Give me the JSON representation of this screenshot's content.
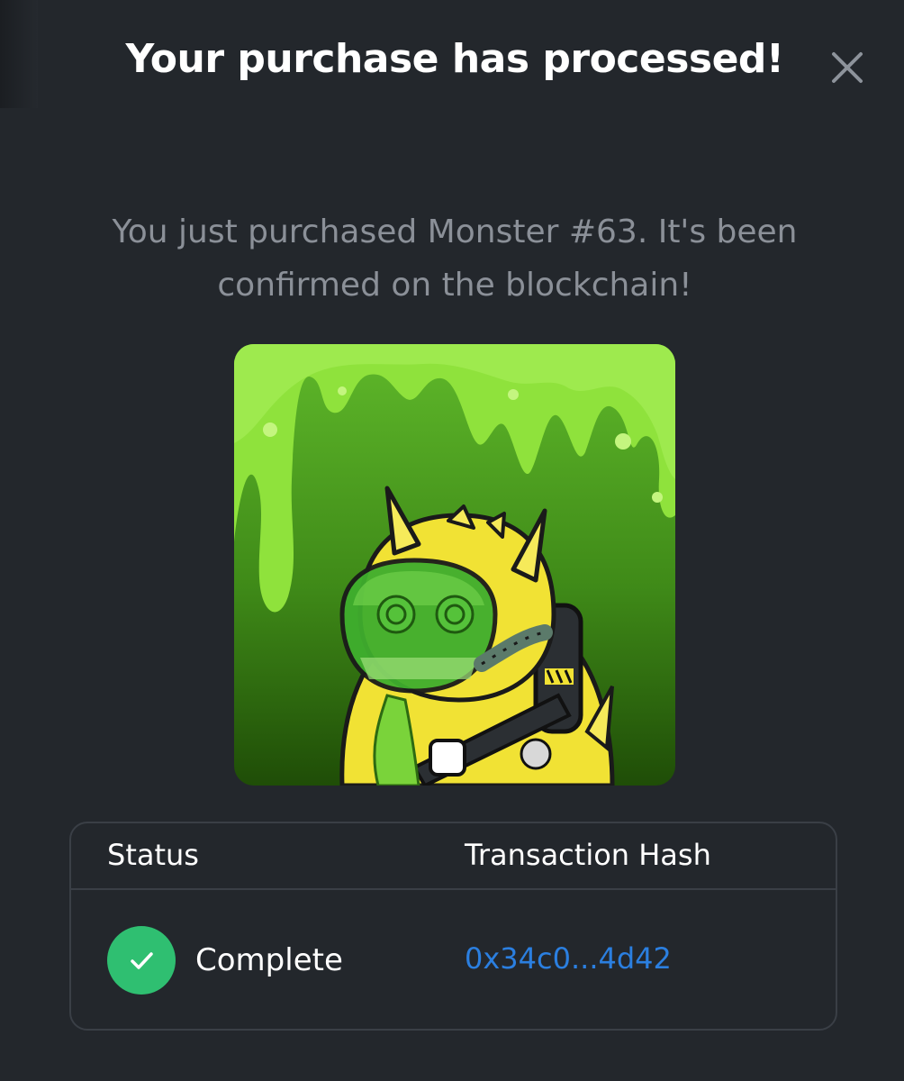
{
  "modal": {
    "title": "Your purchase has processed!",
    "message": "You just purchased Monster #63. It's been confirmed on the blockchain!",
    "close_icon": "close-icon"
  },
  "nft": {
    "image_icon": "monster-artwork"
  },
  "transaction": {
    "status_header": "Status",
    "hash_header": "Transaction Hash",
    "status_icon": "check-circle-icon",
    "status_value": "Complete",
    "hash_value": "0x34c0...4d42"
  },
  "colors": {
    "background": "#23272c",
    "success": "#2fbf71",
    "link": "#2b7fe0",
    "muted_text": "#8b9098",
    "border": "#3a3f46"
  }
}
